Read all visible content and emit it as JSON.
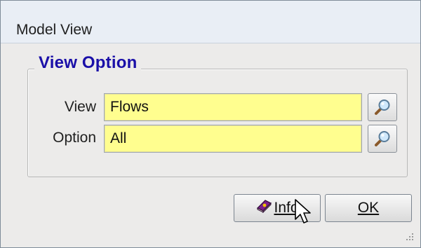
{
  "window": {
    "title": "Model View"
  },
  "group": {
    "title": "View Option"
  },
  "fields": [
    {
      "label": "View",
      "value": "Flows",
      "lookup_icon": "magnifier-icon"
    },
    {
      "label": "Option",
      "value": "All",
      "lookup_icon": "magnifier-icon"
    }
  ],
  "buttons": {
    "info": {
      "label": "Info",
      "icon": "book-icon"
    },
    "ok": {
      "label": "OK"
    }
  },
  "colors": {
    "field_bg": "#fffe8f",
    "group_title": "#1a0fa8",
    "window_bg": "#ecebea",
    "titlebar_bg": "#e9eef5"
  }
}
